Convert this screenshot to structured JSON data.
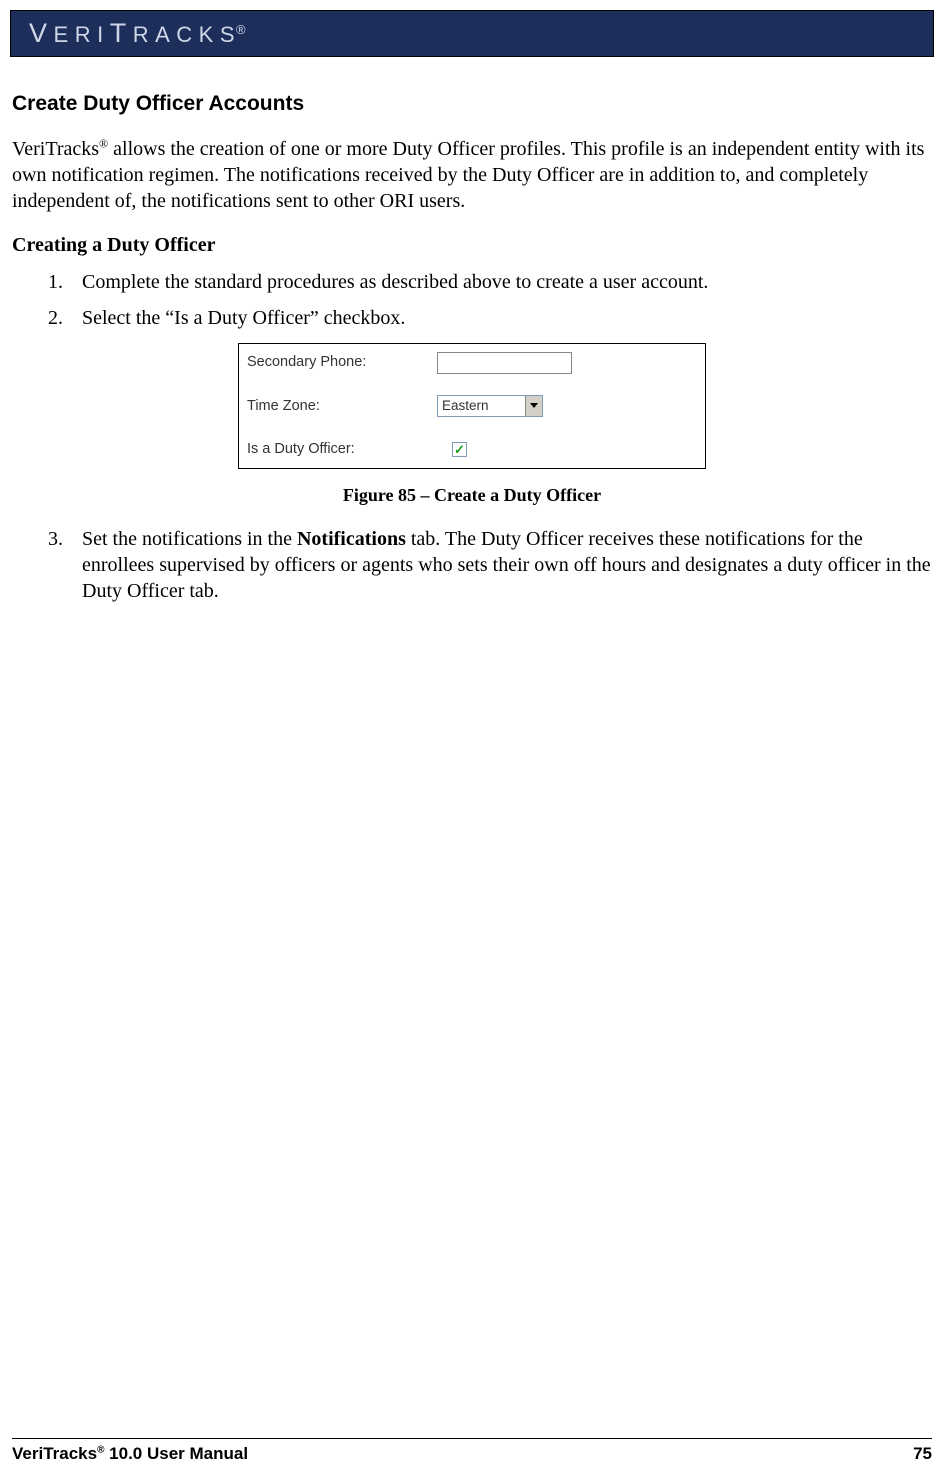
{
  "header": {
    "brand_name": "VERITRACKS",
    "brand_reg": "®"
  },
  "section": {
    "heading": "Create Duty Officer Accounts",
    "intro_prefix": "VeriTracks",
    "intro_reg": "®",
    "intro_text": " allows the creation of one or more Duty Officer profiles. This profile is an independent entity with its own notification regimen. The notifications received by the Duty Officer are in addition to, and completely independent of, the notifications sent to other ORI users.",
    "sub_heading": "Creating a Duty Officer",
    "steps": [
      {
        "num": "1.",
        "text": "Complete the standard procedures as described above to create a user account."
      },
      {
        "num": "2.",
        "text": "Select the “Is a Duty Officer” checkbox."
      },
      {
        "num": "3.",
        "prefix": "Set the notifications in the ",
        "bold": "Notifications",
        "suffix": " tab. The Duty Officer receives these notifications for the enrollees supervised by officers or agents who sets their own off hours and designates a duty officer in the Duty Officer tab."
      }
    ],
    "figure_caption": "Figure 85 – Create a Duty Officer"
  },
  "form": {
    "secondary_phone_label": "Secondary Phone:",
    "secondary_phone_value": "",
    "time_zone_label": "Time Zone:",
    "time_zone_value": "Eastern",
    "duty_officer_label": "Is a Duty Officer:",
    "duty_officer_checked": true
  },
  "footer": {
    "title_prefix": "VeriTracks",
    "title_reg": "®",
    "title_suffix": " 10.0 User Manual",
    "page_number": "75"
  }
}
